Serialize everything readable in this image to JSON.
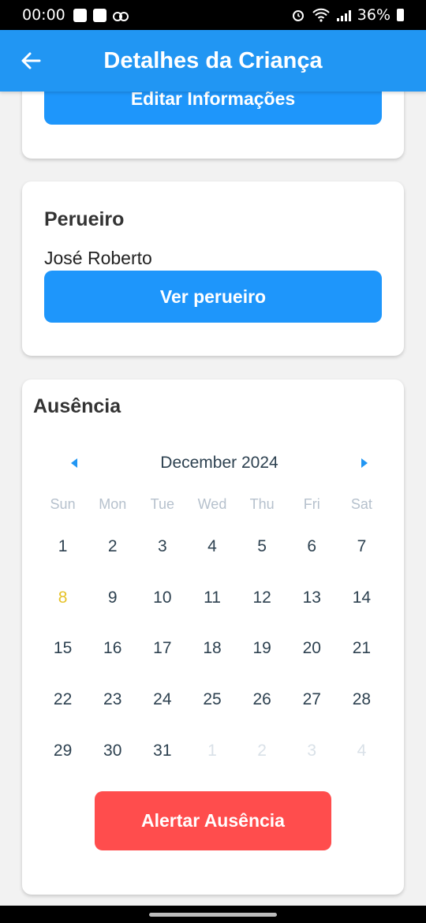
{
  "status_bar": {
    "time": "00:00",
    "battery": "36%"
  },
  "app_bar": {
    "title": "Detalhes da Criança",
    "back_icon": "arrow-back-icon"
  },
  "info_card": {
    "edit_button": "Editar Informações"
  },
  "driver_card": {
    "heading": "Perueiro",
    "driver_name": "José Roberto",
    "view_button": "Ver perueiro"
  },
  "absence_card": {
    "heading": "Ausência",
    "month_label": "December 2024",
    "weekdays": [
      "Sun",
      "Mon",
      "Tue",
      "Wed",
      "Thu",
      "Fri",
      "Sat"
    ],
    "days": [
      {
        "label": "1",
        "state": "current"
      },
      {
        "label": "2",
        "state": "current"
      },
      {
        "label": "3",
        "state": "current"
      },
      {
        "label": "4",
        "state": "current"
      },
      {
        "label": "5",
        "state": "current"
      },
      {
        "label": "6",
        "state": "current"
      },
      {
        "label": "7",
        "state": "current"
      },
      {
        "label": "8",
        "state": "today"
      },
      {
        "label": "9",
        "state": "current"
      },
      {
        "label": "10",
        "state": "current"
      },
      {
        "label": "11",
        "state": "current"
      },
      {
        "label": "12",
        "state": "current"
      },
      {
        "label": "13",
        "state": "current"
      },
      {
        "label": "14",
        "state": "current"
      },
      {
        "label": "15",
        "state": "current"
      },
      {
        "label": "16",
        "state": "current"
      },
      {
        "label": "17",
        "state": "current"
      },
      {
        "label": "18",
        "state": "current"
      },
      {
        "label": "19",
        "state": "current"
      },
      {
        "label": "20",
        "state": "current"
      },
      {
        "label": "21",
        "state": "current"
      },
      {
        "label": "22",
        "state": "current"
      },
      {
        "label": "23",
        "state": "current"
      },
      {
        "label": "24",
        "state": "current"
      },
      {
        "label": "25",
        "state": "current"
      },
      {
        "label": "26",
        "state": "current"
      },
      {
        "label": "27",
        "state": "current"
      },
      {
        "label": "28",
        "state": "current"
      },
      {
        "label": "29",
        "state": "current"
      },
      {
        "label": "30",
        "state": "current"
      },
      {
        "label": "31",
        "state": "current"
      },
      {
        "label": "1",
        "state": "other"
      },
      {
        "label": "2",
        "state": "other"
      },
      {
        "label": "3",
        "state": "other"
      },
      {
        "label": "4",
        "state": "other"
      }
    ],
    "alert_button": "Alertar Ausência"
  },
  "colors": {
    "primary": "#2196f3",
    "button_blue": "#1e96fb",
    "alert_red": "#ff4d4d",
    "today": "#e6c228"
  }
}
